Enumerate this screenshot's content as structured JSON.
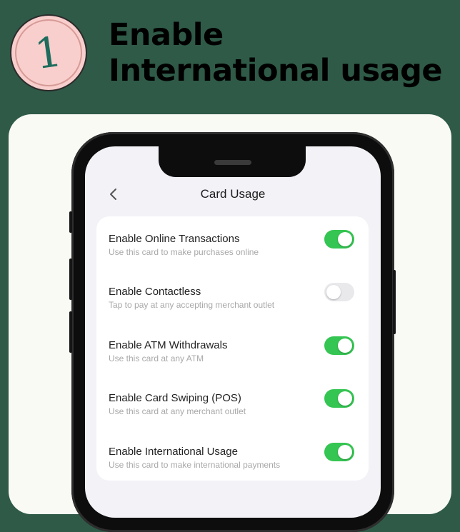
{
  "step": {
    "number": "1",
    "heading": "Enable International usage"
  },
  "screen": {
    "title": "Card Usage",
    "back_icon": "chevron-left-icon"
  },
  "colors": {
    "toggle_on": "#35c552",
    "toggle_off": "#e9e9ec",
    "badge": "#f8cfcd",
    "badge_number": "#1d6c5d"
  },
  "settings": [
    {
      "title": "Enable Online Transactions",
      "subtitle": "Use this card to make purchases online",
      "enabled": true
    },
    {
      "title": "Enable Contactless",
      "subtitle": "Tap to pay at any accepting merchant outlet",
      "enabled": false
    },
    {
      "title": "Enable ATM Withdrawals",
      "subtitle": "Use this card at any ATM",
      "enabled": true
    },
    {
      "title": "Enable Card Swiping (POS)",
      "subtitle": "Use this card at any merchant outlet",
      "enabled": true
    },
    {
      "title": "Enable International Usage",
      "subtitle": "Use this card to make international payments",
      "enabled": true
    }
  ]
}
